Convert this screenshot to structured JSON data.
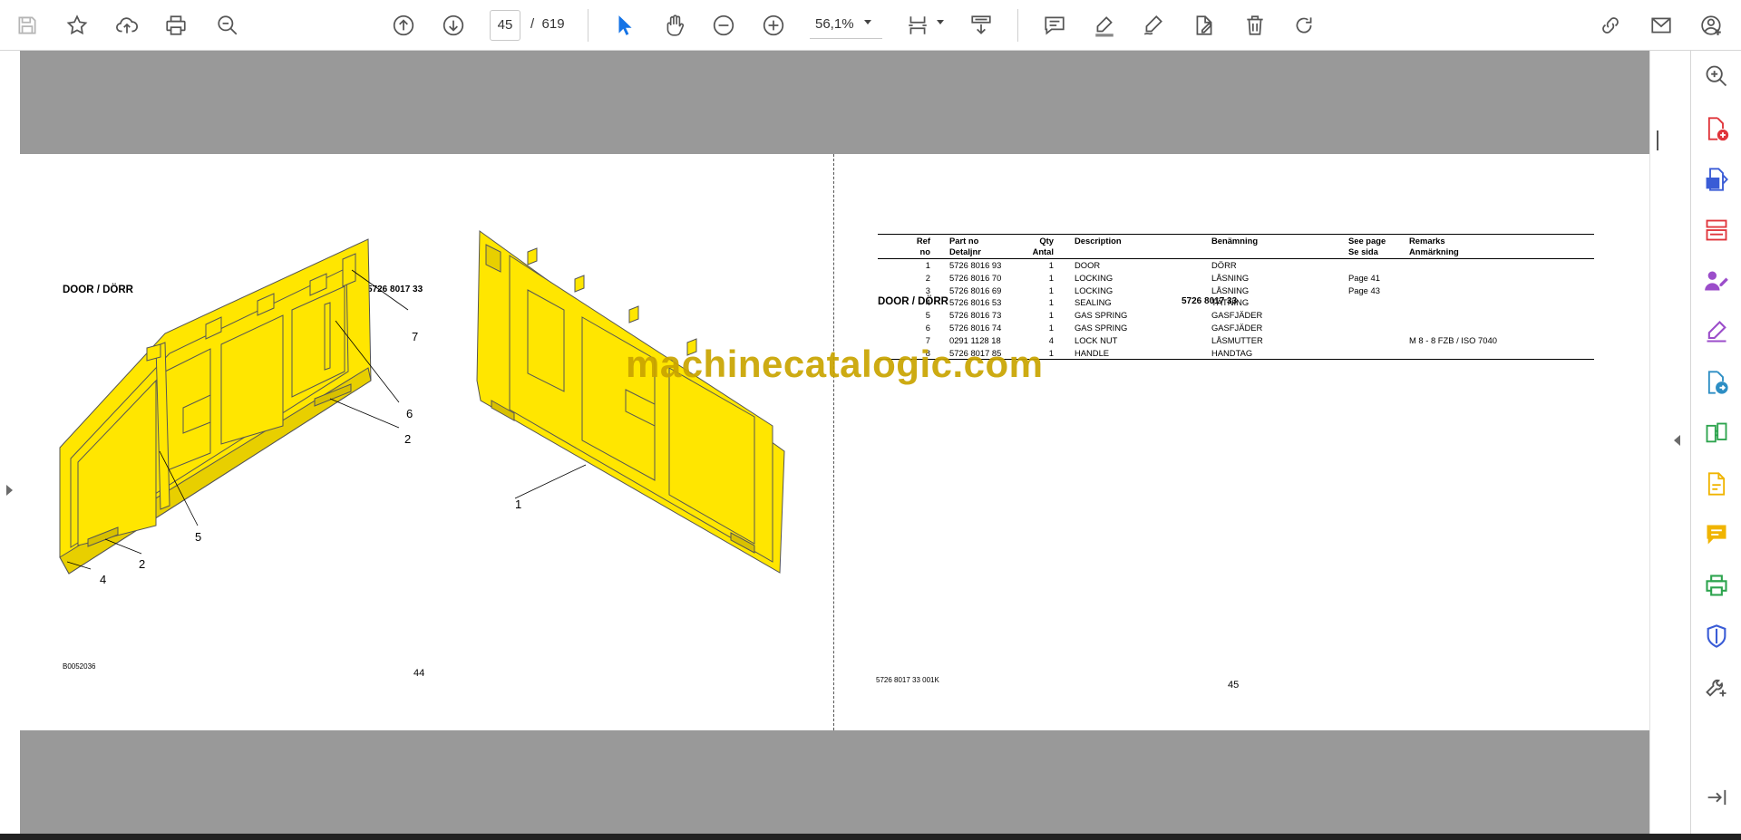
{
  "toolbar": {
    "icons": [
      "save-icon",
      "star-icon",
      "upload-cloud-icon",
      "print-icon",
      "search-zoom-icon",
      "page-up-icon",
      "page-down-icon",
      "select-cursor-icon",
      "hand-tool-icon",
      "zoom-out-icon",
      "zoom-in-icon",
      "fit-page-icon",
      "scroll-mode-icon",
      "comment-icon",
      "highlight-icon",
      "sign-icon",
      "edit-doc-icon",
      "delete-icon",
      "rotate-icon",
      "share-link-icon",
      "mail-icon",
      "account-icon"
    ],
    "current_page": "45",
    "page_separator": "/",
    "total_pages": "619",
    "zoom": "56,1%"
  },
  "left_page": {
    "title": "DOOR / DÖRR",
    "code": "5726 8017 33",
    "callouts": [
      "7",
      "6",
      "2",
      "5",
      "2",
      "4",
      "1"
    ],
    "footer_code": "B0052036",
    "page_number": "44"
  },
  "right_page": {
    "title": "DOOR / DÖRR",
    "code": "5726 8017 33",
    "table": {
      "headers": {
        "ref": [
          "Ref",
          "no"
        ],
        "part": [
          "Part no",
          "Detaljnr"
        ],
        "qty": [
          "Qty",
          "Antal"
        ],
        "desc": [
          "Description",
          ""
        ],
        "ben": [
          "Benämning",
          ""
        ],
        "see": [
          "See page",
          "Se sida"
        ],
        "rem": [
          "Remarks",
          "Anmärkning"
        ]
      },
      "rows": [
        {
          "ref": "1",
          "part": "5726 8016 93",
          "qty": "1",
          "desc": "DOOR",
          "ben": "DÖRR",
          "see": "",
          "rem": ""
        },
        {
          "ref": "2",
          "part": "5726 8016 70",
          "qty": "1",
          "desc": "LOCKING",
          "ben": "LÅSNING",
          "see": "Page 41",
          "rem": ""
        },
        {
          "ref": "3",
          "part": "5726 8016 69",
          "qty": "1",
          "desc": "LOCKING",
          "ben": "LÅSNING",
          "see": "Page 43",
          "rem": ""
        },
        {
          "ref": "4",
          "part": "5726 8016 53",
          "qty": "1",
          "desc": "SEALING",
          "ben": "TÄTNING",
          "see": "",
          "rem": ""
        },
        {
          "ref": "5",
          "part": "5726 8016 73",
          "qty": "1",
          "desc": "GAS SPRING",
          "ben": "GASFJÄDER",
          "see": "",
          "rem": ""
        },
        {
          "ref": "6",
          "part": "5726 8016 74",
          "qty": "1",
          "desc": "GAS SPRING",
          "ben": "GASFJÄDER",
          "see": "",
          "rem": ""
        },
        {
          "ref": "7",
          "part": "0291 1128 18",
          "qty": "4",
          "desc": "LOCK NUT",
          "ben": "LÅSMUTTER",
          "see": "",
          "rem": "M  8 - 8 FZB / ISO 7040"
        },
        {
          "ref": "8",
          "part": "5726 8017 85",
          "qty": "1",
          "desc": "HANDLE",
          "ben": "HANDTAG",
          "see": "",
          "rem": ""
        }
      ]
    },
    "footer_code": "5726 8017 33  001K",
    "page_number": "45"
  },
  "watermark": "machinecatalogic.com",
  "right_panel": {
    "icons": [
      "search-zoom-icon",
      "create-pdf-icon",
      "export-pdf-icon",
      "organize-pages-icon",
      "request-signature-icon",
      "fill-sign-icon",
      "convert-pdf-icon",
      "compare-icon",
      "scan-ocr-icon",
      "comment-icon",
      "print-production-icon",
      "protect-icon",
      "more-tools-icon",
      "collapse-panel-icon"
    ]
  },
  "colors": {
    "viewer_bg": "#999999",
    "door_yellow": "#ffe600",
    "watermark": "#c9a400",
    "accent_blue": "#1473e6",
    "tool_red": "#e0353b",
    "tool_purple": "#9b4dca",
    "tool_green": "#2da44e",
    "tool_yellow": "#f0b400"
  }
}
